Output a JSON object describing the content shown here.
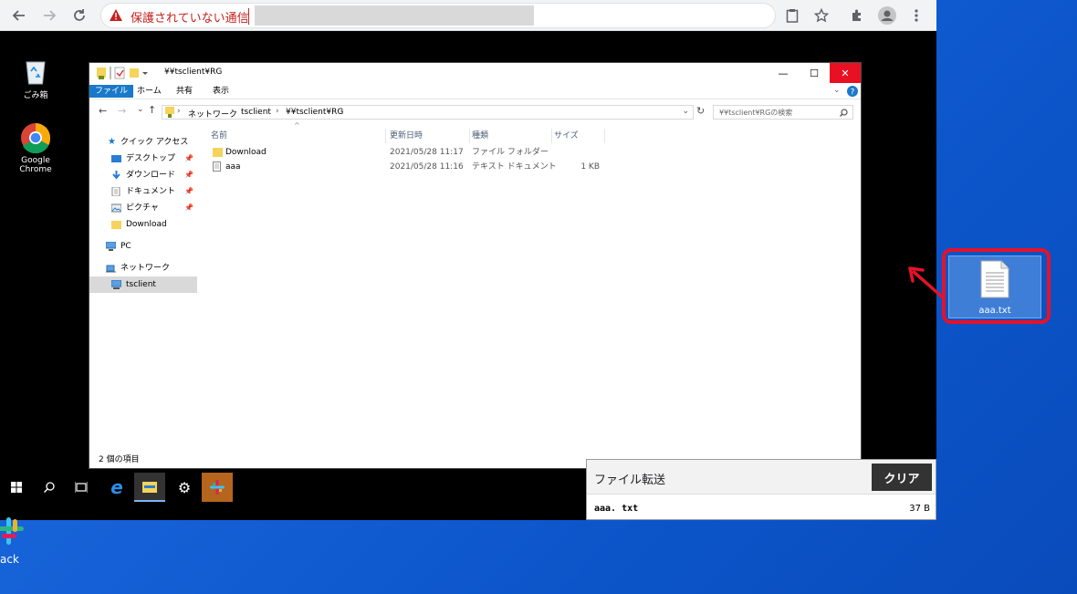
{
  "browser": {
    "security_warning": "保護されていない通信",
    "nav_icons": [
      "back-icon",
      "forward-icon",
      "reload-icon"
    ],
    "toolbar_icons": [
      "clipboard-icon",
      "star-icon",
      "extensions-icon",
      "profile-icon",
      "menu-icon"
    ]
  },
  "remote_desktop": {
    "icons": [
      {
        "label": "ごみ箱",
        "icon": "recycle-bin-icon"
      },
      {
        "label": "Google Chrome",
        "icon": "chrome-icon"
      }
    ]
  },
  "explorer": {
    "title": "¥¥tsclient¥RG",
    "ribbon_tabs": [
      "ファイル",
      "ホーム",
      "共有",
      "表示"
    ],
    "breadcrumb": [
      "ネットワーク",
      "tsclient",
      "¥¥tsclient¥RG"
    ],
    "search_placeholder": "¥¥tsclient¥RGの検索",
    "nav_items": {
      "quick_access": "クイック アクセス",
      "desktop": "デスクトップ",
      "downloads": "ダウンロード",
      "documents": "ドキュメント",
      "pictures": "ピクチャ",
      "download": "Download",
      "pc": "PC",
      "network": "ネットワーク",
      "tsclient": "tsclient"
    },
    "columns": {
      "name": "名前",
      "modified": "更新日時",
      "type": "種類",
      "size": "サイズ"
    },
    "files": [
      {
        "name": "Download",
        "modified": "2021/05/28 11:17",
        "type": "ファイル フォルダー",
        "size": "",
        "kind": "folder"
      },
      {
        "name": "aaa",
        "modified": "2021/05/28 11:16",
        "type": "テキスト ドキュメント",
        "size": "1 KB",
        "kind": "text"
      }
    ],
    "status": "2 個の項目"
  },
  "transfer_panel": {
    "title": "ファイル転送",
    "clear_label": "クリア",
    "file_name": "aaa. txt",
    "file_size": "37 B"
  },
  "local_desktop": {
    "file_label": "aaa.txt",
    "slack_label": "ack",
    "highlight_color": "#e4122b"
  },
  "colors": {
    "desktop_blue": "#1560d6",
    "ribbon_file_tab": "#1979ca",
    "close_button": "#e81123"
  }
}
